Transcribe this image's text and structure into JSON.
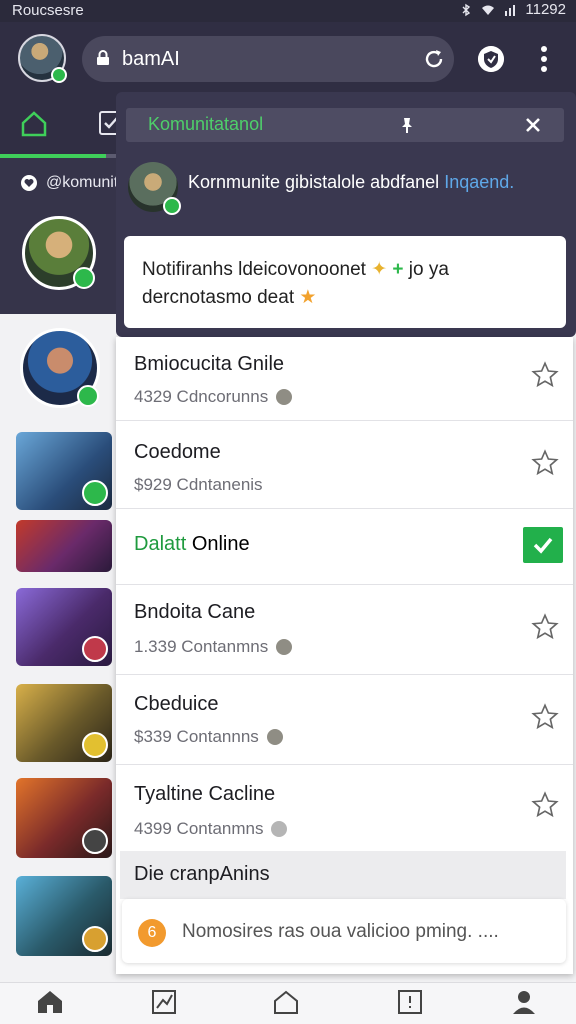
{
  "status_bar": {
    "left_text": "Roucsesre",
    "time": "11292"
  },
  "app_bar": {
    "url_text": "bamAI"
  },
  "background": {
    "community_label": "@komunit"
  },
  "overlay": {
    "header_title": "Komunitatanol",
    "community_text": "Kornmunite gibistalole abdfanel",
    "community_link": "Inqaend.",
    "notification_line1": "Notifiranhs ldeicovonoonet",
    "notification_line1_suffix": "jo ya",
    "notification_line2": "dercnotasmo deat"
  },
  "list": {
    "rows": [
      {
        "name": "Bmiocucita Gnile",
        "meta": "4329 Cdncorunns"
      },
      {
        "name": "Coedome",
        "meta": "$929 Cdntanenis"
      },
      {
        "name": "Bndoita Cane",
        "meta": "1.339 Contanmns"
      },
      {
        "name": "Cbeduice",
        "meta": "$339 Contannns"
      },
      {
        "name": "Tyaltine Cacline",
        "meta": "4399 Contanmns"
      }
    ],
    "online_prefix": "Dalatt",
    "online_suffix": "Online",
    "section_title": "Die cranpAnins",
    "bottom_card_number": "6",
    "bottom_card_text": "Nomosires ras oua valicioo pming. ...."
  },
  "colors": {
    "accent_green": "#2db84b",
    "dark_bar": "#302e43",
    "link_blue": "#5fa8e8"
  }
}
